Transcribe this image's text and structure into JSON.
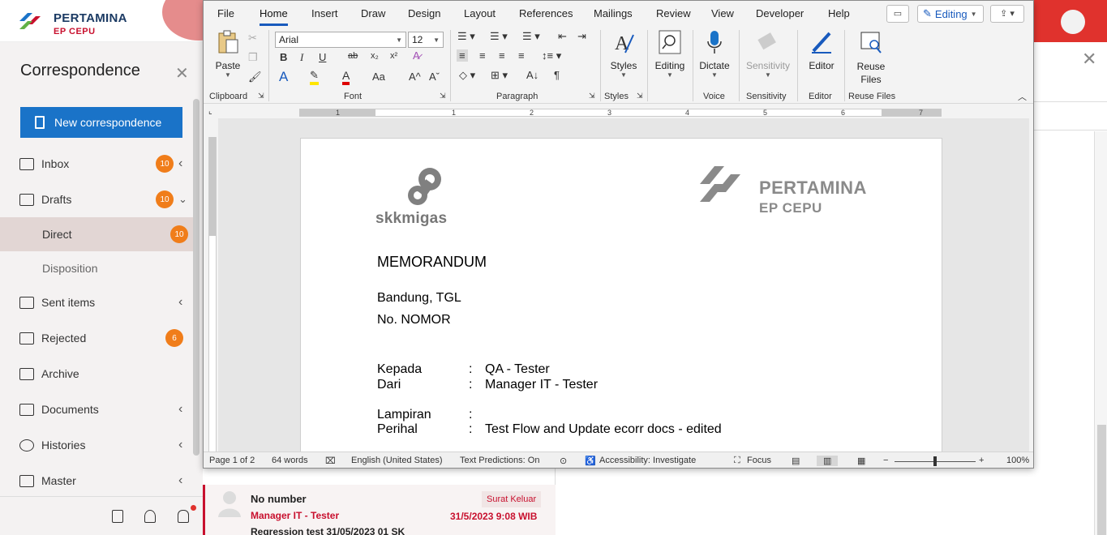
{
  "app": {
    "logo_title": "PERTAMINA",
    "logo_sub": "EP CEPU",
    "brand_red": "#c8102e",
    "brand_blue": "#1a73c8",
    "sidebar": {
      "title": "Correspondence",
      "new_button": "New correspondence",
      "items": [
        {
          "label": "Inbox",
          "badge": "10",
          "icon": "inbox-icon"
        },
        {
          "label": "Drafts",
          "badge": "10",
          "icon": "drafts-icon"
        },
        {
          "label": "Direct",
          "badge": "10"
        },
        {
          "label": "Disposition"
        },
        {
          "label": "Sent items",
          "icon": "sent-icon"
        },
        {
          "label": "Rejected",
          "badge": "6",
          "icon": "rejected-icon"
        },
        {
          "label": "Archive",
          "icon": "archive-icon"
        },
        {
          "label": "Documents",
          "icon": "documents-icon"
        },
        {
          "label": "Histories",
          "icon": "history-icon"
        },
        {
          "label": "Master",
          "icon": "master-icon"
        }
      ]
    },
    "list_item": {
      "title": "No number",
      "tag": "Surat Keluar",
      "from": "Manager IT - Tester",
      "date": "31/5/2023 9:08 WIB",
      "subject": "Regression test 31/05/2023 01 SK"
    }
  },
  "word": {
    "tabs": [
      "File",
      "Home",
      "Insert",
      "Draw",
      "Design",
      "Layout",
      "References",
      "Mailings",
      "Review",
      "View",
      "Developer",
      "Help"
    ],
    "active_tab": "Home",
    "editing_label": "Editing",
    "font_name": "Arial",
    "font_size": "12",
    "ribbon": {
      "paste": "Paste",
      "styles": "Styles",
      "editing": "Editing",
      "dictate": "Dictate",
      "sensitivity": "Sensitivity",
      "editor": "Editor",
      "reuse_files": "Reuse Files"
    },
    "groups": [
      "Clipboard",
      "Font",
      "Paragraph",
      "Styles",
      "Voice",
      "Sensitivity",
      "Editor",
      "Reuse Files"
    ],
    "ruler_numbers": [
      "1",
      "1",
      "2",
      "3",
      "4",
      "5",
      "6",
      "7"
    ],
    "document": {
      "logo_left": "skkmigas",
      "logo_right_title": "PERTAMINA",
      "logo_right_sub": "EP CEPU",
      "heading": "MEMORANDUM",
      "place_date": "Bandung,  TGL",
      "number": "No.  NOMOR",
      "fields": [
        {
          "label": "Kepada",
          "value": "QA - Tester"
        },
        {
          "label": "Dari",
          "value": "Manager IT - Tester"
        },
        {
          "label": "Lampiran",
          "value": ""
        },
        {
          "label": "Perihal",
          "value": "Test Flow and Update ecorr docs - edited"
        }
      ]
    },
    "status": {
      "page": "Page 1 of 2",
      "words": "64 words",
      "language": "English (United States)",
      "predictions": "Text Predictions: On",
      "accessibility": "Accessibility: Investigate",
      "focus": "Focus",
      "zoom": "100%"
    }
  }
}
